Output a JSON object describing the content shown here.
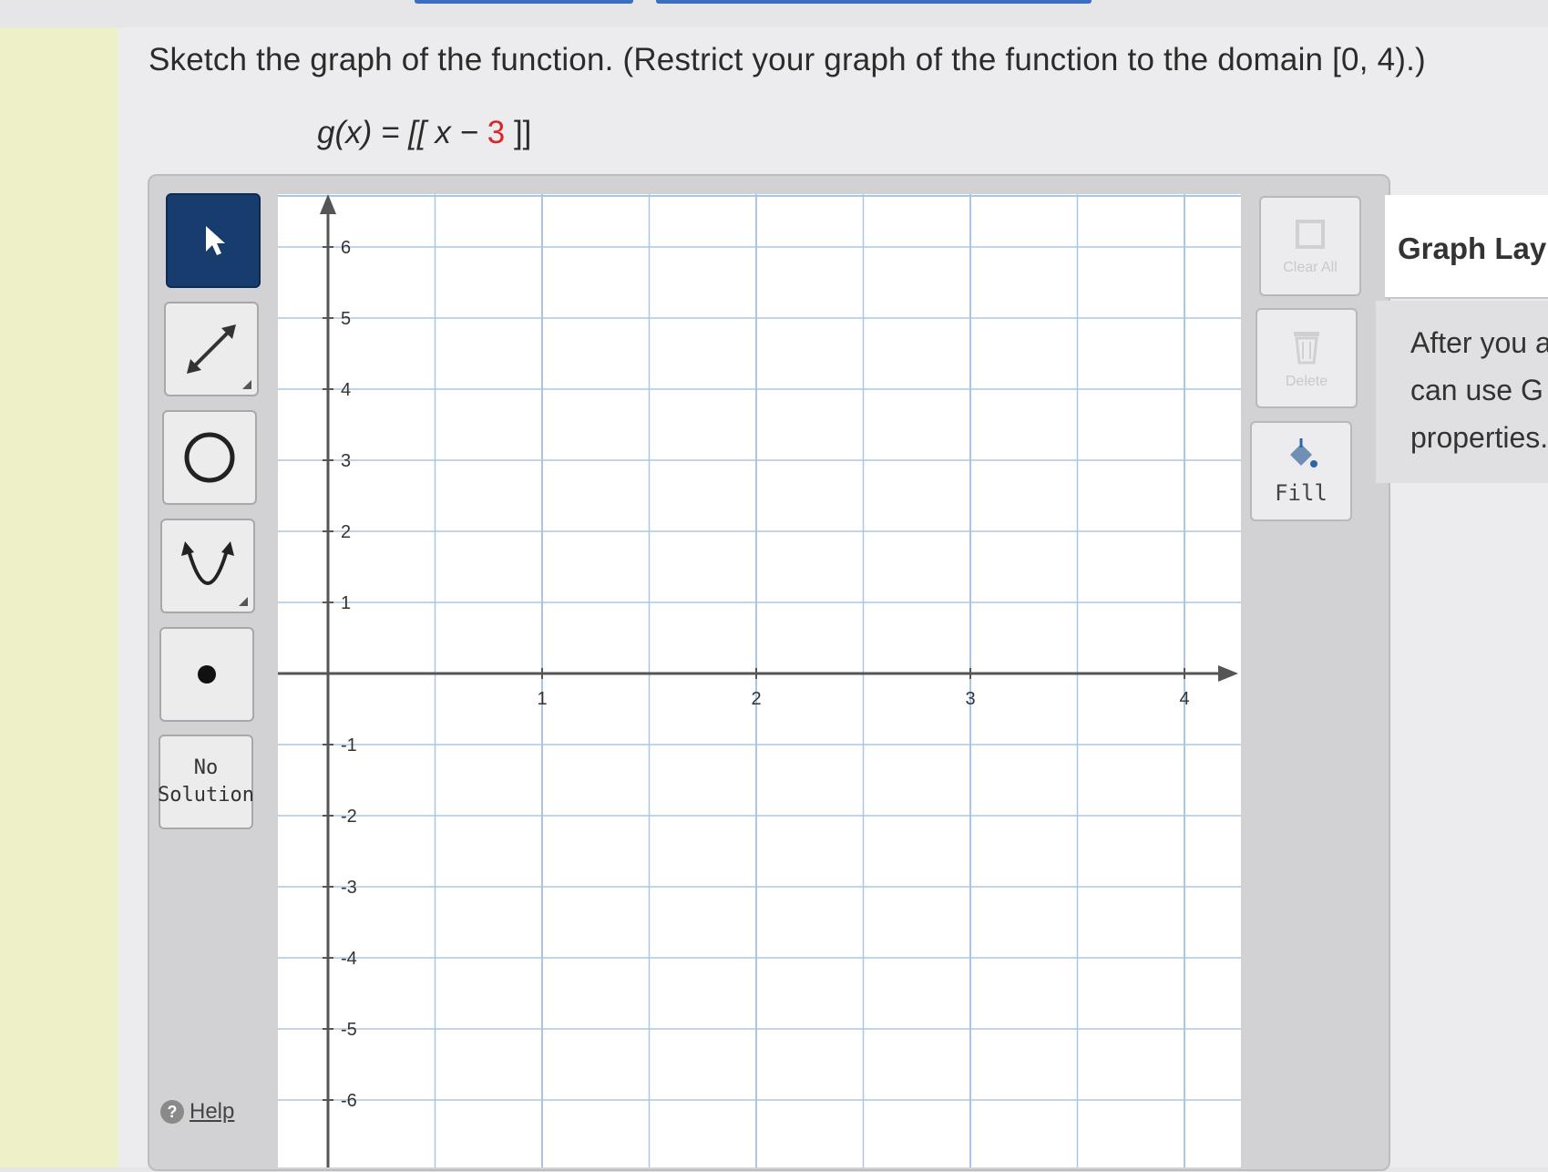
{
  "question": {
    "prompt": "Sketch the graph of the function. (Restrict your graph of the function to the domain [0, 4).)",
    "formula_lhs": "g(x) = [[",
    "formula_var": " x − ",
    "formula_const": "3",
    "formula_close": " ]]"
  },
  "toolbar": {
    "tools": [
      {
        "name": "select-tool",
        "icon": "arrow-pointer-icon",
        "active": true
      },
      {
        "name": "line-tool",
        "icon": "line-segment-icon",
        "active": false
      },
      {
        "name": "circle-tool",
        "icon": "circle-icon",
        "active": false
      },
      {
        "name": "parabola-tool",
        "icon": "parabola-icon",
        "active": false
      },
      {
        "name": "point-tool",
        "icon": "point-icon",
        "active": false
      }
    ],
    "no_solution_line1": "No",
    "no_solution_line2": "Solution",
    "help_label": "Help"
  },
  "graph": {
    "x_ticks": [
      "1",
      "2",
      "3",
      "4"
    ],
    "y_ticks_pos": [
      "6",
      "5",
      "4",
      "3",
      "2",
      "1"
    ],
    "y_ticks_neg": [
      "-1",
      "-2",
      "-3",
      "-4",
      "-5",
      "-6"
    ],
    "x_range": [
      0,
      4
    ],
    "y_range": [
      -6,
      6
    ]
  },
  "actions": {
    "clear_all_label": "Clear All",
    "delete_label": "Delete",
    "fill_label": "Fill"
  },
  "sidebar": {
    "title": "Graph Lay",
    "line1": "After you a",
    "line2": "can use G",
    "line3": "properties."
  },
  "colors": {
    "active_tool": "#173d6e",
    "grid_line": "#a9c7e3",
    "axis": "#555555",
    "formula_constant": "#d9262b"
  }
}
